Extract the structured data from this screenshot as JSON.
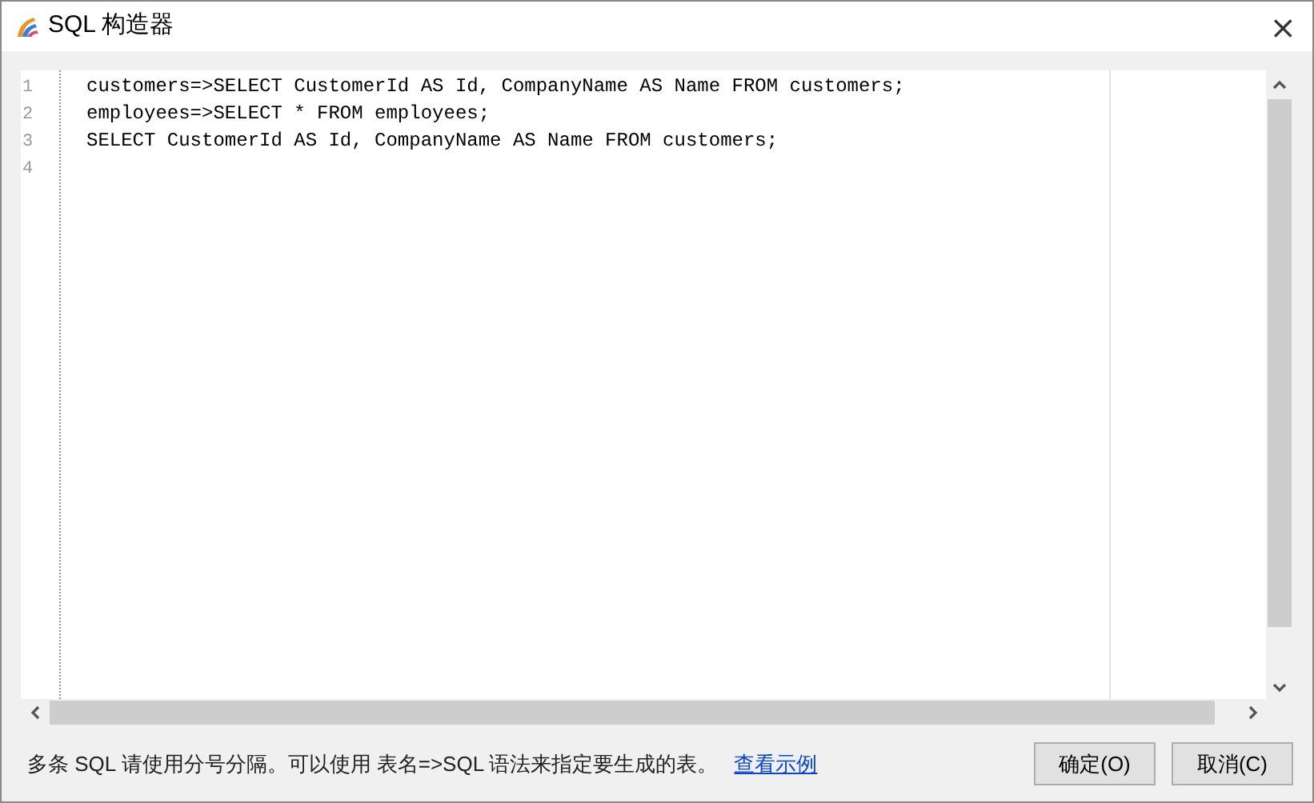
{
  "window": {
    "title": "SQL 构造器",
    "close": "×"
  },
  "editor": {
    "line_numbers": [
      "1",
      "2",
      "3",
      "4"
    ],
    "lines": [
      "customers=>SELECT CustomerId AS Id, CompanyName AS Name FROM customers;",
      "employees=>SELECT * FROM employees;",
      "SELECT CustomerId AS Id, CompanyName AS Name FROM customers;"
    ]
  },
  "footer": {
    "hint": "多条 SQL 请使用分号分隔。可以使用 表名=>SQL 语法来指定要生成的表。",
    "link": "查看示例"
  },
  "buttons": [
    "确定(O)",
    "取消(C)"
  ]
}
